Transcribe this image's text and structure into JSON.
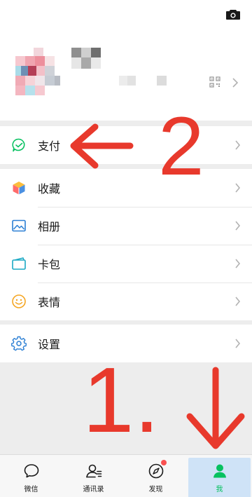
{
  "profile": {
    "camera_icon": "camera-icon",
    "qr_icon": "qr-code-icon"
  },
  "menu_groups": [
    {
      "items": [
        {
          "label": "支付",
          "icon": "pay-icon"
        }
      ]
    },
    {
      "items": [
        {
          "label": "收藏",
          "icon": "favorites-icon"
        },
        {
          "label": "相册",
          "icon": "album-icon"
        },
        {
          "label": "卡包",
          "icon": "card-wallet-icon"
        },
        {
          "label": "表情",
          "icon": "sticker-icon"
        }
      ]
    },
    {
      "items": [
        {
          "label": "设置",
          "icon": "settings-icon"
        }
      ]
    }
  ],
  "annotations": {
    "step2": "2",
    "step1": "1."
  },
  "tabbar": {
    "tabs": [
      {
        "label": "微信",
        "icon": "chat-icon",
        "active": false
      },
      {
        "label": "通讯录",
        "icon": "contacts-icon",
        "active": false
      },
      {
        "label": "发现",
        "icon": "discover-compass-icon",
        "active": false,
        "badge_dot": true
      },
      {
        "label": "我",
        "icon": "me-icon",
        "active": true
      }
    ]
  },
  "colors": {
    "accent": "#07c160",
    "annotation": "#e8392c",
    "badge": "#fa5151",
    "active_tab_bg": "#cfe3f7"
  }
}
